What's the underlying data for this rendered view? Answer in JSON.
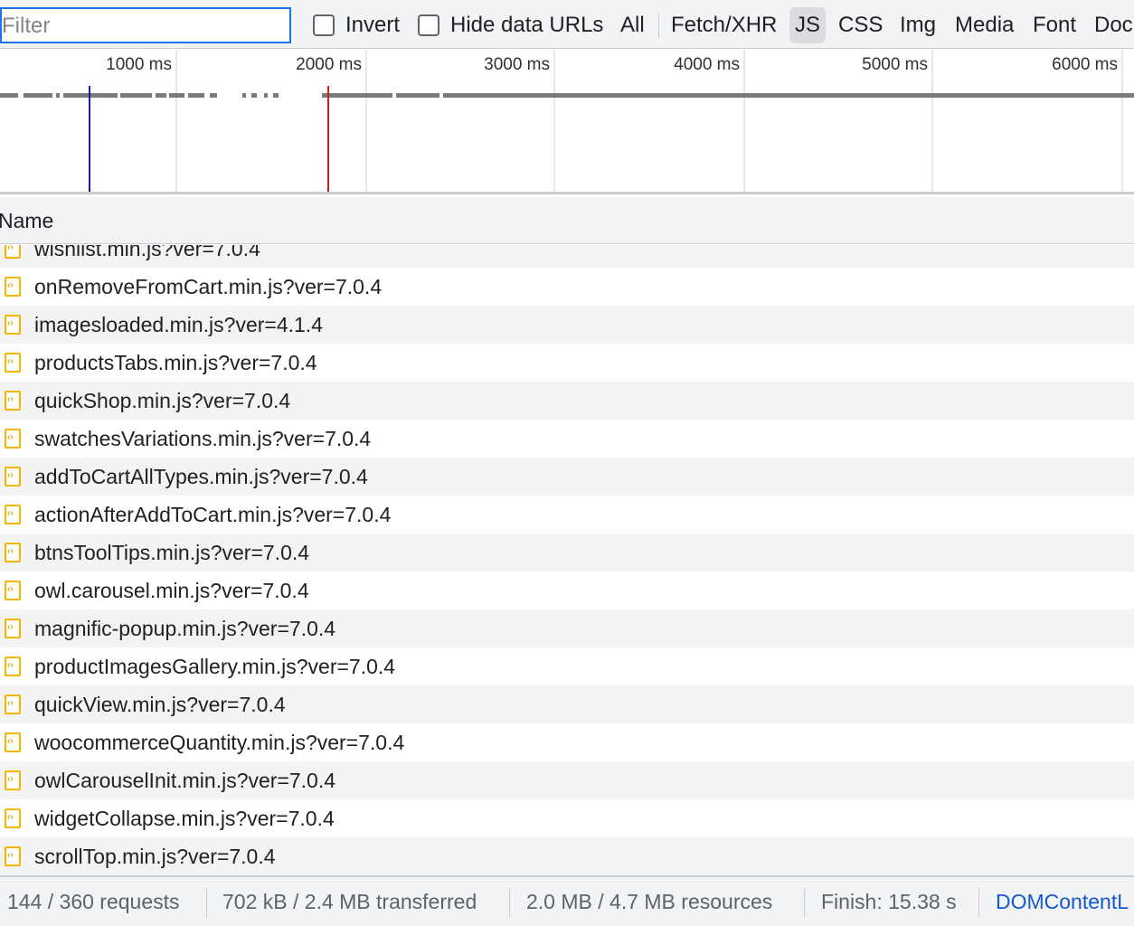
{
  "toolbar": {
    "filter_placeholder": "Filter",
    "invert_label": "Invert",
    "hide_data_urls_label": "Hide data URLs",
    "types": [
      {
        "label": "All",
        "active": false
      },
      {
        "label": "Fetch/XHR",
        "active": false
      },
      {
        "label": "JS",
        "active": true
      },
      {
        "label": "CSS",
        "active": false
      },
      {
        "label": "Img",
        "active": false
      },
      {
        "label": "Media",
        "active": false
      },
      {
        "label": "Font",
        "active": false
      },
      {
        "label": "Doc",
        "active": false
      }
    ]
  },
  "overview": {
    "ticks": [
      "1000 ms",
      "2000 ms",
      "3000 ms",
      "4000 ms",
      "5000 ms",
      "6000 ms"
    ],
    "dom_content_loaded_color": "#1a1a9e",
    "load_color": "#c5221f"
  },
  "table": {
    "column_name": "Name",
    "rows": [
      "wishlist.min.js?ver=7.0.4",
      "onRemoveFromCart.min.js?ver=7.0.4",
      "imagesloaded.min.js?ver=4.1.4",
      "productsTabs.min.js?ver=7.0.4",
      "quickShop.min.js?ver=7.0.4",
      "swatchesVariations.min.js?ver=7.0.4",
      "addToCartAllTypes.min.js?ver=7.0.4",
      "actionAfterAddToCart.min.js?ver=7.0.4",
      "btnsToolTips.min.js?ver=7.0.4",
      "owl.carousel.min.js?ver=7.0.4",
      "magnific-popup.min.js?ver=7.0.4",
      "productImagesGallery.min.js?ver=7.0.4",
      "quickView.min.js?ver=7.0.4",
      "woocommerceQuantity.min.js?ver=7.0.4",
      "owlCarouselInit.min.js?ver=7.0.4",
      "widgetCollapse.min.js?ver=7.0.4",
      "scrollTop.min.js?ver=7.0.4"
    ],
    "icon": "js-file-icon",
    "icon_color": "#f4b400"
  },
  "status": {
    "requests": "144 / 360 requests",
    "transferred": "702 kB / 2.4 MB transferred",
    "resources": "2.0 MB / 4.7 MB resources",
    "finish": "Finish: 15.38 s",
    "dom_content_loaded": "DOMContentL"
  }
}
